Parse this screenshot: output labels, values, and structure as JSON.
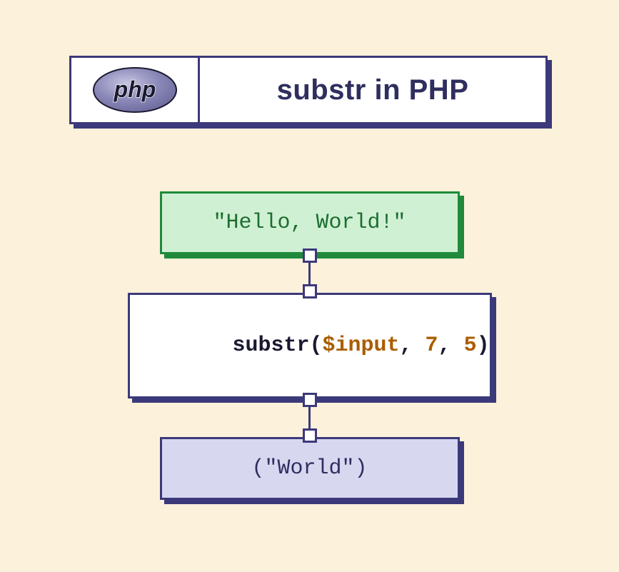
{
  "header": {
    "logo_text": "php",
    "title": "substr in PHP"
  },
  "flow": {
    "input_literal": "\"Hello, World!\"",
    "call": {
      "func": "substr",
      "open": "(",
      "var": "$input",
      "sep1": ", ",
      "arg_start": "7",
      "sep2": ", ",
      "arg_len": "5",
      "close": ")"
    },
    "output_literal": "(\"World\")"
  }
}
